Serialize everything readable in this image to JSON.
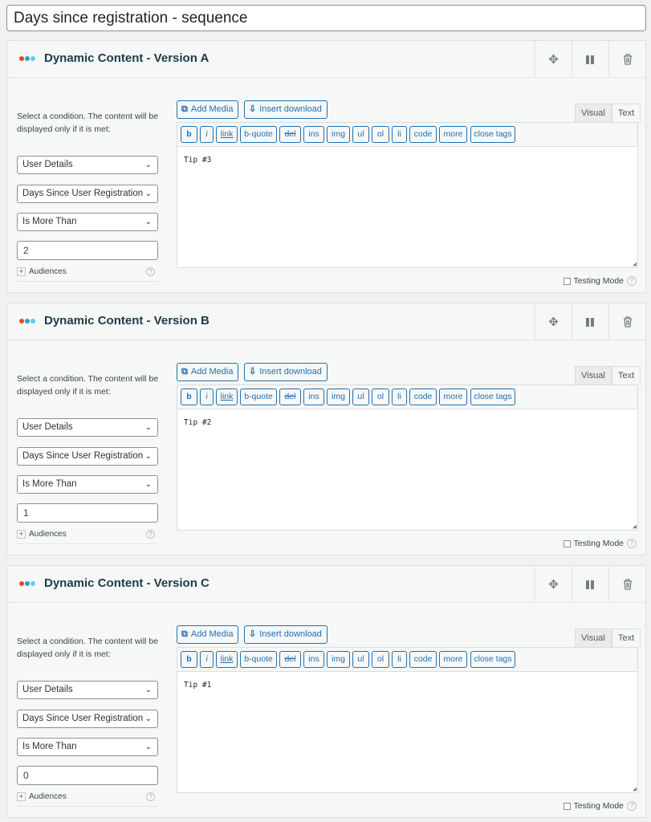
{
  "title": "Days since registration - sequence",
  "icons": {
    "logo_dots": [
      "#e2492f",
      "#1fa8c9",
      "#5ad0e0"
    ],
    "move": "move-icon",
    "pause": "pause-icon",
    "trash": "trash-icon"
  },
  "common": {
    "description": "Select a condition. The content will be displayed only if it is met:",
    "add_media": "Add Media",
    "insert_download": "Insert download",
    "tab_visual": "Visual",
    "tab_text": "Text",
    "quicktags": [
      "b",
      "i",
      "link",
      "b-quote",
      "del",
      "ins",
      "img",
      "ul",
      "ol",
      "li",
      "code",
      "more",
      "close tags"
    ],
    "audiences": "Audiences",
    "testing_mode": "Testing Mode",
    "help": "?"
  },
  "panels": [
    {
      "title": "Dynamic Content - Version A",
      "condition": "User Details",
      "field": "Days Since User Registration",
      "operator": "Is More Than",
      "value": "2",
      "content": "Tip #3"
    },
    {
      "title": "Dynamic Content - Version B",
      "condition": "User Details",
      "field": "Days Since User Registration",
      "operator": "Is More Than",
      "value": "1",
      "content": "Tip #2"
    },
    {
      "title": "Dynamic Content - Version C",
      "condition": "User Details",
      "field": "Days Since User Registration",
      "operator": "Is More Than",
      "value": "0",
      "content": "Tip #1"
    }
  ]
}
